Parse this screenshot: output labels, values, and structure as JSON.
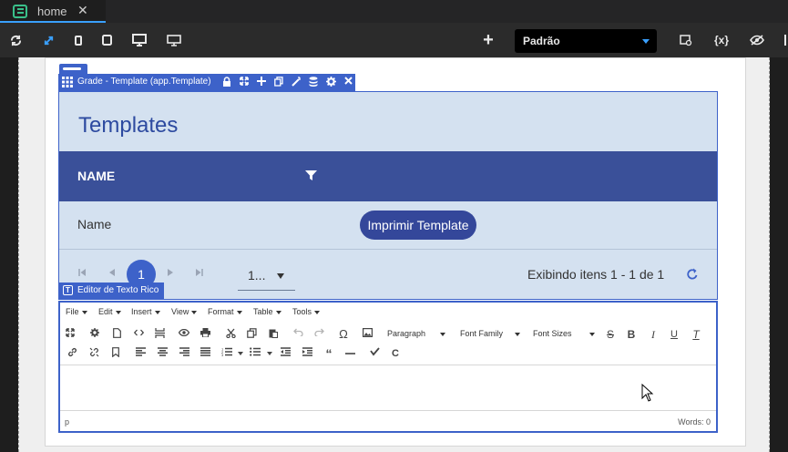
{
  "tab": {
    "title": "home",
    "close": "✕"
  },
  "toolbar": {
    "icons": [
      "refresh-icon",
      "fullscreen-icon",
      "mobile-icon",
      "tablet-icon",
      "desktop-icon",
      "monitor-icon"
    ],
    "add": "+",
    "theme_select": "Padrão",
    "vars_label": "{x}"
  },
  "grade": {
    "component_label": "Grade - Template (app.Template)",
    "title": "Templates",
    "column_header": "NAME",
    "row_cell": "Name",
    "print_button": "Imprimir Template",
    "pager": {
      "current_page": "1",
      "page_size": "1...",
      "info": "Exibindo itens 1 - 1 de 1"
    }
  },
  "editor": {
    "component_label": "Editor de Texto Rico",
    "menu": [
      "File",
      "Edit",
      "Insert",
      "View",
      "Format",
      "Table",
      "Tools"
    ],
    "paragraph": "Paragraph",
    "font_family": "Font Family",
    "font_sizes": "Font Sizes",
    "path": "p",
    "words": "Words: 0"
  },
  "colors": {
    "accent": "#3d62c9",
    "header": "#3a5099",
    "grid_bg": "#d4e1f0",
    "title": "#2d4aa0"
  }
}
